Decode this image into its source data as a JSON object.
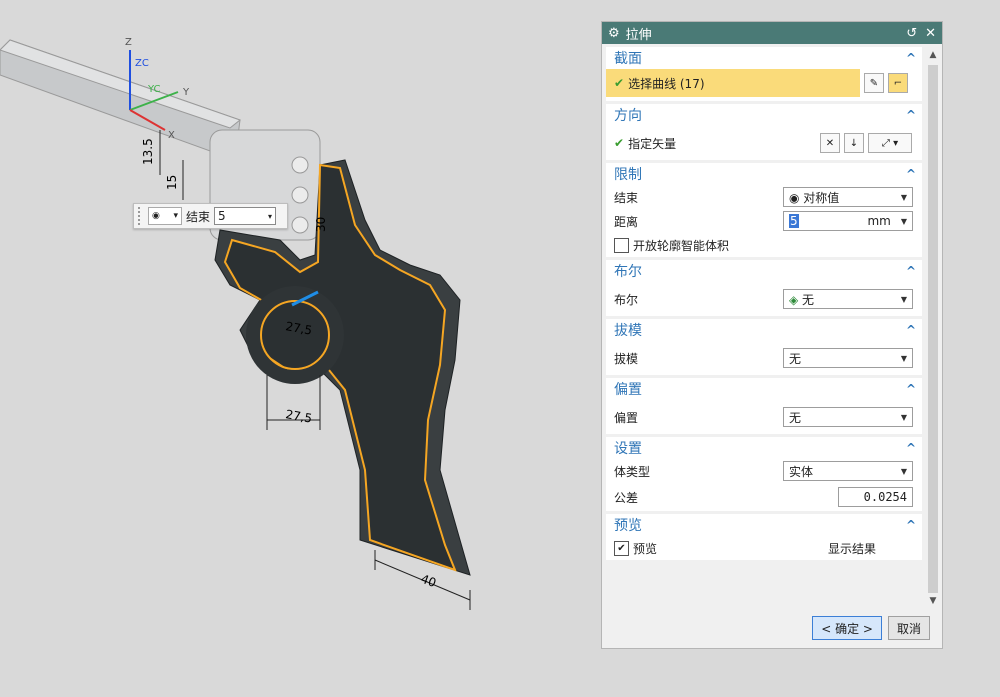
{
  "viewport": {
    "axis_labels": {
      "z": "Z",
      "zc": "ZC",
      "yc": "YC",
      "y": "Y",
      "x": "X"
    },
    "dimensions": [
      "13.5",
      "15",
      "30",
      "27,5",
      "27,5",
      "40",
      "5"
    ],
    "float_bar": {
      "end_label": "结束",
      "end_value": "5"
    }
  },
  "dialog": {
    "title": "拉伸",
    "sections": {
      "section": {
        "header": "截面",
        "select_curve": "选择曲线 (17)"
      },
      "direction": {
        "header": "方向",
        "specify_vector": "指定矢量"
      },
      "limits": {
        "header": "限制",
        "end_label": "结束",
        "end_value": "对称值",
        "distance_label": "距离",
        "distance_value": "5",
        "distance_unit": "mm",
        "open_profile_label": "开放轮廓智能体积"
      },
      "boolean": {
        "header": "布尔",
        "label": "布尔",
        "value": "无"
      },
      "draft": {
        "header": "拔模",
        "label": "拔模",
        "value": "无"
      },
      "offset": {
        "header": "偏置",
        "label": "偏置",
        "value": "无"
      },
      "settings": {
        "header": "设置",
        "body_type_label": "体类型",
        "body_type_value": "实体",
        "tolerance_label": "公差",
        "tolerance_value": "0.0254"
      },
      "preview": {
        "header": "预览",
        "preview_label": "预览",
        "show_result_label": "显示结果"
      }
    },
    "buttons": {
      "ok": "< 确定 >",
      "cancel": "取消"
    }
  },
  "colors": {
    "title_bar": "#4a7a76",
    "section_header": "#3076b7",
    "selection_highlight": "#fadb7a",
    "curve_highlight": "#f5a623",
    "solid_body": "#2e3436"
  }
}
